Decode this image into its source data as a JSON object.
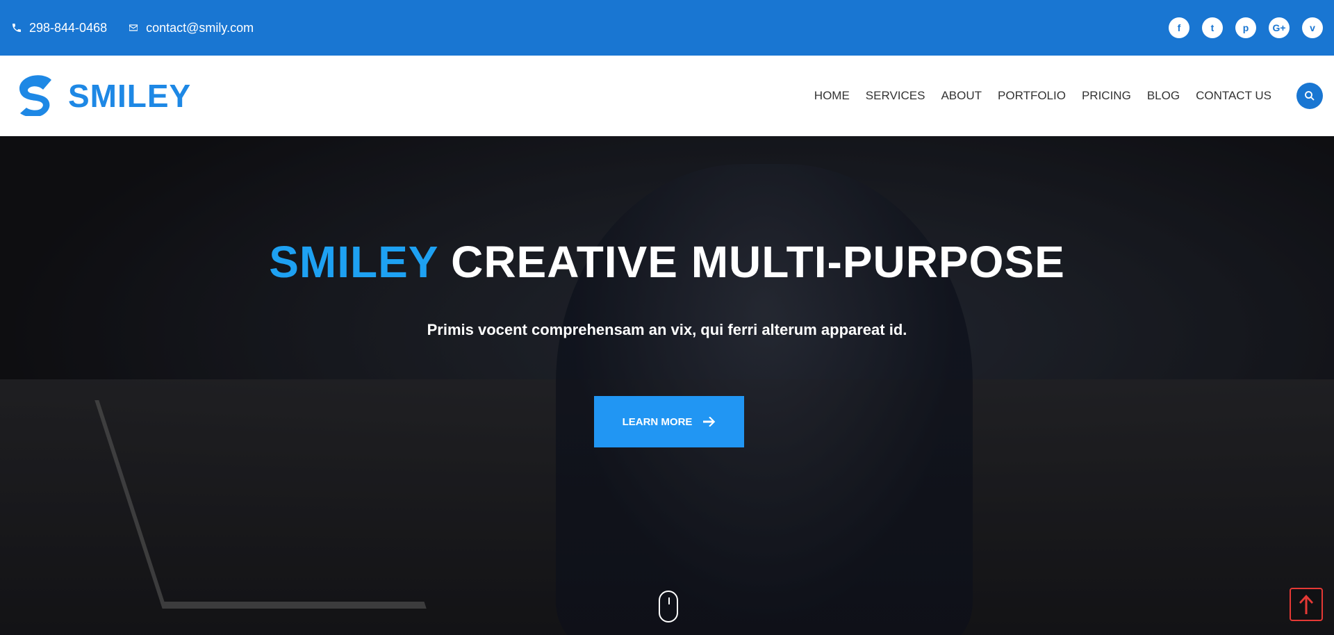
{
  "topbar": {
    "phone": "298-844-0468",
    "email": "contact@smily.com",
    "socials": [
      {
        "label": "f",
        "name": "facebook-icon"
      },
      {
        "label": "t",
        "name": "twitter-icon"
      },
      {
        "label": "p",
        "name": "pinterest-icon"
      },
      {
        "label": "G+",
        "name": "google-plus-icon"
      },
      {
        "label": "v",
        "name": "vimeo-icon"
      }
    ]
  },
  "header": {
    "brand": "SMILEY",
    "nav": [
      "HOME",
      "SERVICES",
      "ABOUT",
      "PORTFOLIO",
      "PRICING",
      "BLOG",
      "CONTACT US"
    ]
  },
  "hero": {
    "title_accent": "SMILEY",
    "title_rest": "CREATIVE MULTI-PURPOSE",
    "subtitle": "Primis vocent comprehensam an vix, qui ferri alterum appareat id.",
    "cta_label": "LEARN MORE"
  },
  "colors": {
    "topbar": "#1976d2",
    "accent": "#1ea1f2",
    "cta": "#2196f3",
    "backtop": "#e53935"
  }
}
